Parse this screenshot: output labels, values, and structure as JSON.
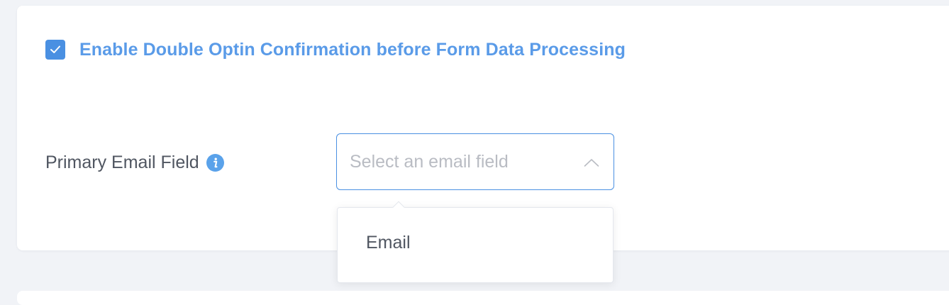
{
  "optin": {
    "checked": true,
    "label": "Enable Double Optin Confirmation before Form Data Processing"
  },
  "primary_email": {
    "label": "Primary Email Field",
    "info_icon": "info-icon",
    "select_placeholder": "Select an email field",
    "options": [
      "Email"
    ]
  },
  "colors": {
    "accent": "#4a90e2",
    "label_blue": "#5a9be8",
    "text": "#505661",
    "placeholder": "#b9bcc3",
    "page_bg": "#f1f3f7"
  }
}
